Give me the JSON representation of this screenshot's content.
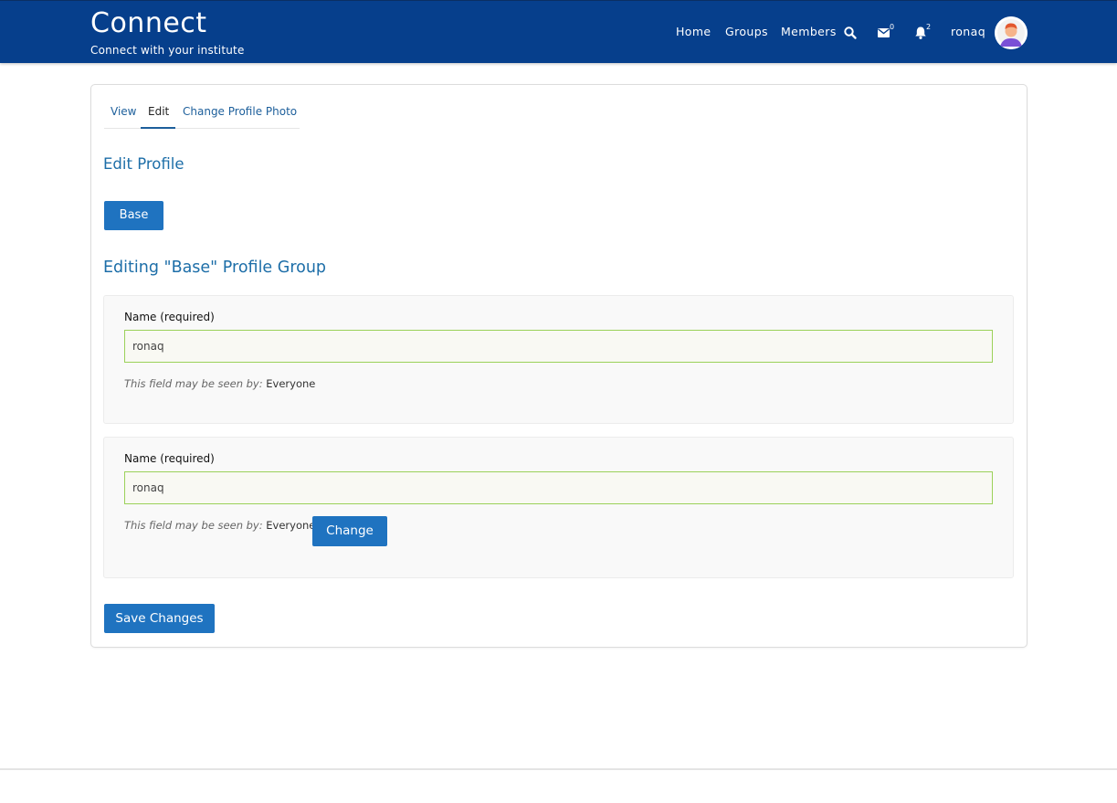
{
  "header": {
    "site_title": "Connect",
    "tagline": "Connect with your institute",
    "nav": [
      "Home",
      "Groups",
      "Members"
    ],
    "messages_count": "0",
    "notifications_count": "2",
    "username": "ronaq",
    "icons": [
      "search-icon",
      "envelope-icon",
      "bell-icon"
    ]
  },
  "tabs": {
    "view": "View",
    "edit": "Edit",
    "change_photo": "Change Profile Photo",
    "active": "Edit"
  },
  "main": {
    "heading": "Edit Profile",
    "group_button": "Base",
    "group_heading": "Editing \"Base\" Profile Group"
  },
  "fields": [
    {
      "label": "Name (required)",
      "value": "ronaq",
      "visibility_label": "This field may be seen by:",
      "visibility_value": "Everyone"
    },
    {
      "label": "Name (required)",
      "value": "ronaq",
      "visibility_label": "This field may be seen by:",
      "visibility_value": "Everyone",
      "change_label": "Change"
    }
  ],
  "actions": {
    "save_label": "Save Changes"
  },
  "colors": {
    "header_bg": "#063f8c",
    "accent": "#1f73c0",
    "input_border": "#9bd15a"
  }
}
